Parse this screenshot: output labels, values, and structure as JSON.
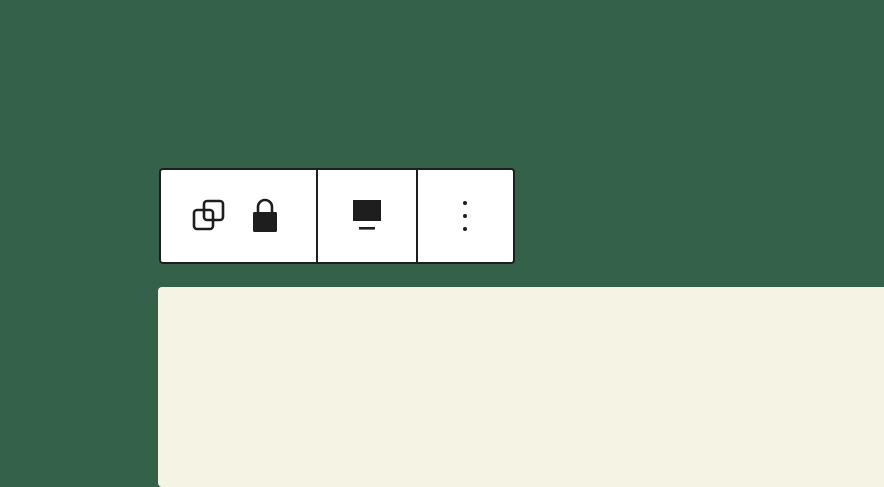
{
  "colors": {
    "background": "#33614a",
    "panel": "#f5f3e3",
    "toolbar_bg": "#ffffff",
    "icon": "#1e1e1e"
  },
  "toolbar": {
    "duplicate_icon": "duplicate-icon",
    "lock_icon": "lock-icon",
    "visibility_icon": "desktop-icon",
    "options_icon": "more-vertical-icon"
  }
}
